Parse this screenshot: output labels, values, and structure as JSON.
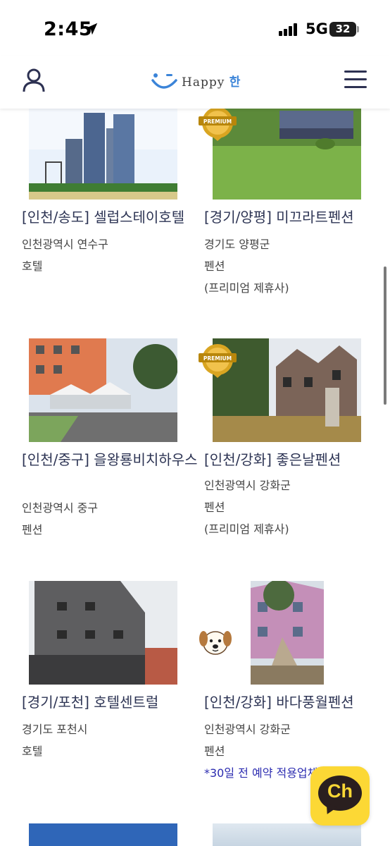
{
  "status_bar": {
    "time": "2:45",
    "network": "5G",
    "battery": "32"
  },
  "header": {
    "logo_text": "Happy",
    "logo_han": "한"
  },
  "cards": [
    {
      "title": "[인천/송도] 셀럽스테이호텔",
      "location": "인천광역시 연수구",
      "category": "호텔",
      "note": "",
      "premium": false
    },
    {
      "title": "[경기/양평] 미끄라트펜션",
      "location": "경기도 양평군",
      "category": "펜션",
      "note": "(프리미엄 제휴사)",
      "premium": true
    },
    {
      "title": "[인천/중구] 을왕룡비치하우스",
      "location": "인천광역시 중구",
      "category": "펜션",
      "note": "",
      "premium": false
    },
    {
      "title": "[인천/강화] 좋은날펜션",
      "location": "인천광역시 강화군",
      "category": "펜션",
      "note": "(프리미엄 제휴사)",
      "premium": true
    },
    {
      "title": "[경기/포천] 호텔센트럴",
      "location": "경기도 포천시",
      "category": "호텔",
      "note": "",
      "premium": false
    },
    {
      "title": "[인천/강화] 바다풍월펜션",
      "location": "인천광역시 강화군",
      "category": "펜션",
      "note": "*30일 전 예약 적용업체",
      "premium": false,
      "pet_friendly": true
    }
  ],
  "premium_badge": "PREMIUM",
  "chat_button": "Ch",
  "colors": {
    "title": "#2d3454",
    "promo": "#2c2cb0",
    "kakao": "#fcd835",
    "logo_accent": "#3b84d8"
  }
}
